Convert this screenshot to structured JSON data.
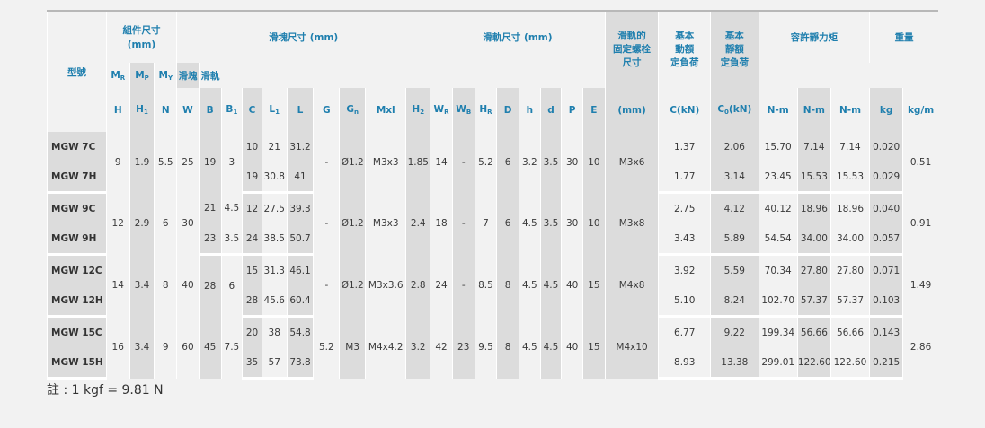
{
  "header": {
    "model": "型號",
    "assembly": "組件尺寸\n(mm)",
    "block": "滑塊尺寸 (mm)",
    "rail": "滑軌尺寸 (mm)",
    "rail_bolt": "滑軌的\n固定螺栓\n尺寸",
    "dynamic_load": "基本\n動額\n定負荷",
    "static_load": "基本\n靜額\n定負荷",
    "moment": "容許靜力矩",
    "weight": "重量",
    "block_w": "滑塊",
    "rail_w": "滑軌",
    "mr": "M",
    "mr_sub": "R",
    "mp": "M",
    "mp_sub": "P",
    "my": "M",
    "my_sub": "Y",
    "cols": [
      {
        "t": "H",
        "s": ""
      },
      {
        "t": "H",
        "s": "1"
      },
      {
        "t": "N",
        "s": ""
      },
      {
        "t": "W",
        "s": ""
      },
      {
        "t": "B",
        "s": ""
      },
      {
        "t": "B",
        "s": "1"
      },
      {
        "t": "C",
        "s": ""
      },
      {
        "t": "L",
        "s": "1"
      },
      {
        "t": "L",
        "s": ""
      },
      {
        "t": "G",
        "s": ""
      },
      {
        "t": "G",
        "s": "n"
      },
      {
        "t": "Mxl",
        "s": ""
      },
      {
        "t": "H",
        "s": "2"
      },
      {
        "t": "W",
        "s": "R"
      },
      {
        "t": "W",
        "s": "B"
      },
      {
        "t": "H",
        "s": "R"
      },
      {
        "t": "D",
        "s": ""
      },
      {
        "t": "h",
        "s": ""
      },
      {
        "t": "d",
        "s": ""
      },
      {
        "t": "P",
        "s": ""
      },
      {
        "t": "E",
        "s": ""
      },
      {
        "t": "(mm)",
        "s": ""
      },
      {
        "t": "C(kN)",
        "s": ""
      },
      {
        "t": "C",
        "s": "0",
        "t2": "(kN)"
      },
      {
        "t": "N-m",
        "s": ""
      },
      {
        "t": "N-m",
        "s": ""
      },
      {
        "t": "N-m",
        "s": ""
      },
      {
        "t": "kg",
        "s": ""
      },
      {
        "t": "kg/m",
        "s": ""
      }
    ]
  },
  "groups": [
    {
      "rows": [
        {
          "model": "MGW 7C",
          "C": "10",
          "L1": "21",
          "L": "31.2",
          "Cdyn": "1.37",
          "C0": "2.06",
          "MR": "15.70",
          "MP": "7.14",
          "MY": "7.14",
          "blk_w": "0.020"
        },
        {
          "model": "MGW 7H",
          "C": "19",
          "L1": "30.8",
          "L": "41",
          "Cdyn": "1.77",
          "C0": "3.14",
          "MR": "23.45",
          "MP": "15.53",
          "MY": "15.53",
          "blk_w": "0.029"
        }
      ],
      "H": "9",
      "H1": "1.9",
      "N": "5.5",
      "W": "25",
      "B": "19",
      "B1": "3",
      "B1_split": false,
      "G": "-",
      "Gn": "Ø1.2",
      "Mxl": "M3x3",
      "H2": "1.85",
      "WR": "14",
      "WB": "-",
      "HR": "5.2",
      "D": "6",
      "h": "3.2",
      "d": "3.5",
      "P": "30",
      "E": "10",
      "bolt": "M3x6",
      "rail_w": "0.51"
    },
    {
      "rows": [
        {
          "model": "MGW 9C",
          "B1": "4.5",
          "C": "12",
          "L1": "27.5",
          "L": "39.3",
          "Cdyn": "2.75",
          "C0": "4.12",
          "MR": "40.12",
          "MP": "18.96",
          "MY": "18.96",
          "blk_w": "0.040"
        },
        {
          "model": "MGW 9H",
          "B1": "3.5",
          "C": "24",
          "L1": "38.5",
          "L": "50.7",
          "Cdyn": "3.43",
          "C0": "5.89",
          "MR": "54.54",
          "MP": "34.00",
          "MY": "34.00",
          "blk_w": "0.057"
        }
      ],
      "H": "12",
      "H1": "2.9",
      "N": "6",
      "W": "30",
      "B": "21",
      "B_rows": [
        "21",
        "23"
      ],
      "B1_split": true,
      "G": "-",
      "Gn": "Ø1.2",
      "Mxl": "M3x3",
      "H2": "2.4",
      "WR": "18",
      "WB": "-",
      "HR": "7",
      "D": "6",
      "h": "4.5",
      "d": "3.5",
      "P": "30",
      "E": "10",
      "bolt": "M3x8",
      "rail_w": "0.91"
    },
    {
      "rows": [
        {
          "model": "MGW 12C",
          "C": "15",
          "L1": "31.3",
          "L": "46.1",
          "Cdyn": "3.92",
          "C0": "5.59",
          "MR": "70.34",
          "MP": "27.80",
          "MY": "27.80",
          "blk_w": "0.071"
        },
        {
          "model": "MGW 12H",
          "C": "28",
          "L1": "45.6",
          "L": "60.4",
          "Cdyn": "5.10",
          "C0": "8.24",
          "MR": "102.70",
          "MP": "57.37",
          "MY": "57.37",
          "blk_w": "0.103"
        }
      ],
      "H": "14",
      "H1": "3.4",
      "N": "8",
      "W": "40",
      "B": "28",
      "B1": "6",
      "B1_split": false,
      "G": "-",
      "Gn": "Ø1.2",
      "Mxl": "M3x3.6",
      "H2": "2.8",
      "WR": "24",
      "WB": "-",
      "HR": "8.5",
      "D": "8",
      "h": "4.5",
      "d": "4.5",
      "P": "40",
      "E": "15",
      "bolt": "M4x8",
      "rail_w": "1.49"
    },
    {
      "rows": [
        {
          "model": "MGW 15C",
          "C": "20",
          "L1": "38",
          "L": "54.8",
          "Cdyn": "6.77",
          "C0": "9.22",
          "MR": "199.34",
          "MP": "56.66",
          "MY": "56.66",
          "blk_w": "0.143"
        },
        {
          "model": "MGW 15H",
          "C": "35",
          "L1": "57",
          "L": "73.8",
          "Cdyn": "8.93",
          "C0": "13.38",
          "MR": "299.01",
          "MP": "122.60",
          "MY": "122.60",
          "blk_w": "0.215"
        }
      ],
      "H": "16",
      "H1": "3.4",
      "N": "9",
      "W": "60",
      "B": "45",
      "B1": "7.5",
      "B1_split": false,
      "G": "5.2",
      "Gn": "M3",
      "Mxl": "M4x4.2",
      "H2": "3.2",
      "WR": "42",
      "WB": "23",
      "HR": "9.5",
      "D": "8",
      "h": "4.5",
      "d": "4.5",
      "P": "40",
      "E": "15",
      "bolt": "M4x10",
      "rail_w": "2.86"
    }
  ],
  "note": "註 : 1 kgf = 9.81 N"
}
